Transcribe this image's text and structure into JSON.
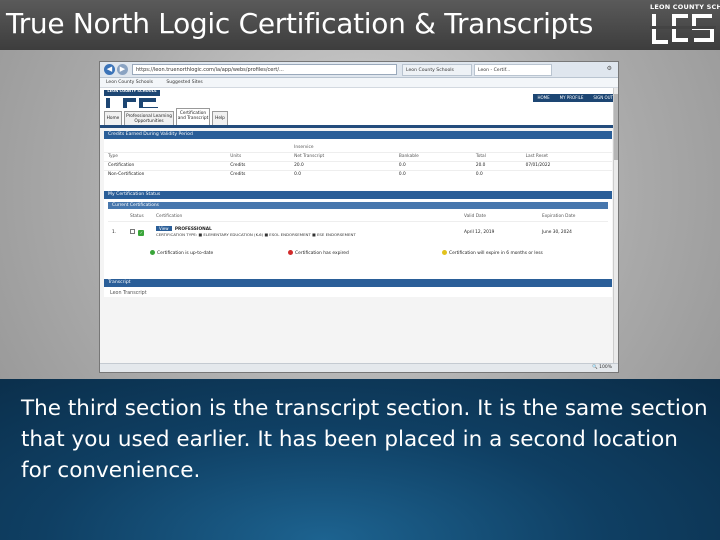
{
  "slide": {
    "title": "True North Logic Certification & Transcripts",
    "logo_text": "LEON COUNTY SCHOOLS",
    "caption": "The third section is the transcript section. It is the same section that you used earlier. It has been placed in a second location for convenience."
  },
  "browser": {
    "url": "https://leon.truenorthlogic.com/ia/app/webs/profiles/cert/...",
    "tabs": [
      {
        "label": "Leon County Schools"
      },
      {
        "label": "Leon - Certif..."
      }
    ],
    "favorites": [
      "Leon County Schools",
      "Suggested Sites"
    ],
    "zoom": "100%"
  },
  "site": {
    "logo_text": "LEON COUNTY SCHOOLS",
    "user_links": [
      "HOME",
      "MY PROFILE",
      "SIGN OUT"
    ],
    "menu_tabs": [
      "Home",
      "Professional Learning Opportunities",
      "Certification and Transcript",
      "Help"
    ],
    "active_tab": 2
  },
  "credits_section": {
    "title": "Credits Earned During Validity Period",
    "group_header": "Inservice",
    "columns": [
      "Type",
      "Units",
      "Net Transcript",
      "Bankable",
      "Total",
      "Last Reset"
    ],
    "rows": [
      [
        "Certification",
        "Credits",
        "20.0",
        "0.0",
        "20.0",
        "07/01/2022"
      ],
      [
        "Non-Certification",
        "Credits",
        "0.0",
        "0.0",
        "0.0",
        ""
      ]
    ]
  },
  "certification_status": {
    "title": "My Certification Status",
    "subtitle": "Current Certifications",
    "columns": [
      "",
      "Status",
      "Certification",
      "Valid Date",
      "Expiration Date"
    ],
    "row": {
      "index": "1.",
      "badge": "View",
      "name": "PROFESSIONAL",
      "detail": "CERTIFICATION TYPE: ■ ELEMENTARY EDUCATION (K-6) ■ ESOL ENDORSEMENT ■ ESE ENDORSEMENT",
      "valid_date": "April 12, 2019",
      "expiration_date": "June 30, 2024"
    },
    "legend": [
      {
        "label": "Certification is up-to-date",
        "color": "#3aa53a"
      },
      {
        "label": "Certification has expired",
        "color": "#d12a2a"
      },
      {
        "label": "Certification will expire in 6 months or less",
        "color": "#e2c21c"
      }
    ]
  },
  "transcript_section": {
    "title": "Transcript",
    "subtitle": "Leon Transcript"
  },
  "colors": {
    "title_bar": "#444444",
    "section_blue": "#2a5e98",
    "caption_blue": "#0f3f63"
  }
}
